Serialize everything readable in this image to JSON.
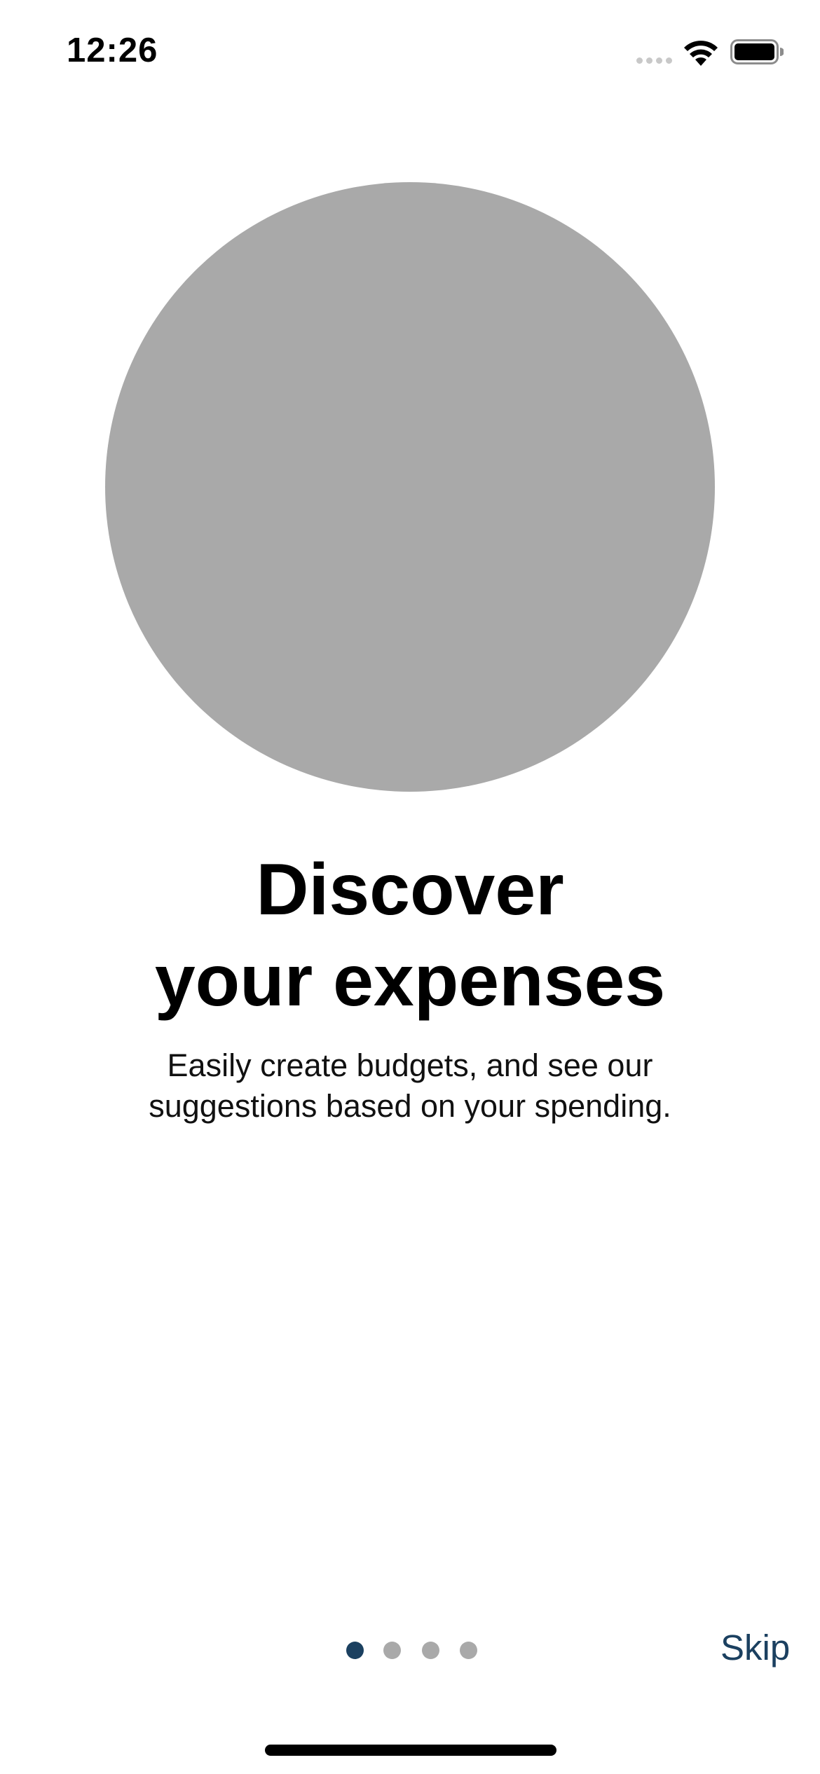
{
  "status_bar": {
    "time": "12:26",
    "signal_icon": "cellular-signal-icon",
    "wifi_icon": "wifi-icon",
    "battery_icon": "battery-full-icon"
  },
  "onboarding": {
    "title_line1": "Discover",
    "title_line2": "your expenses",
    "subtitle_line1": "Easily create budgets, and see our",
    "subtitle_line2": "suggestions based on your spending.",
    "illustration_color": "#a9a9a9",
    "page_count": 4,
    "current_page": 1,
    "active_dot_color": "#1b4060",
    "inactive_dot_color": "#a9a9a9"
  },
  "footer": {
    "skip_label": "Skip",
    "accent_color": "#1b4060"
  }
}
